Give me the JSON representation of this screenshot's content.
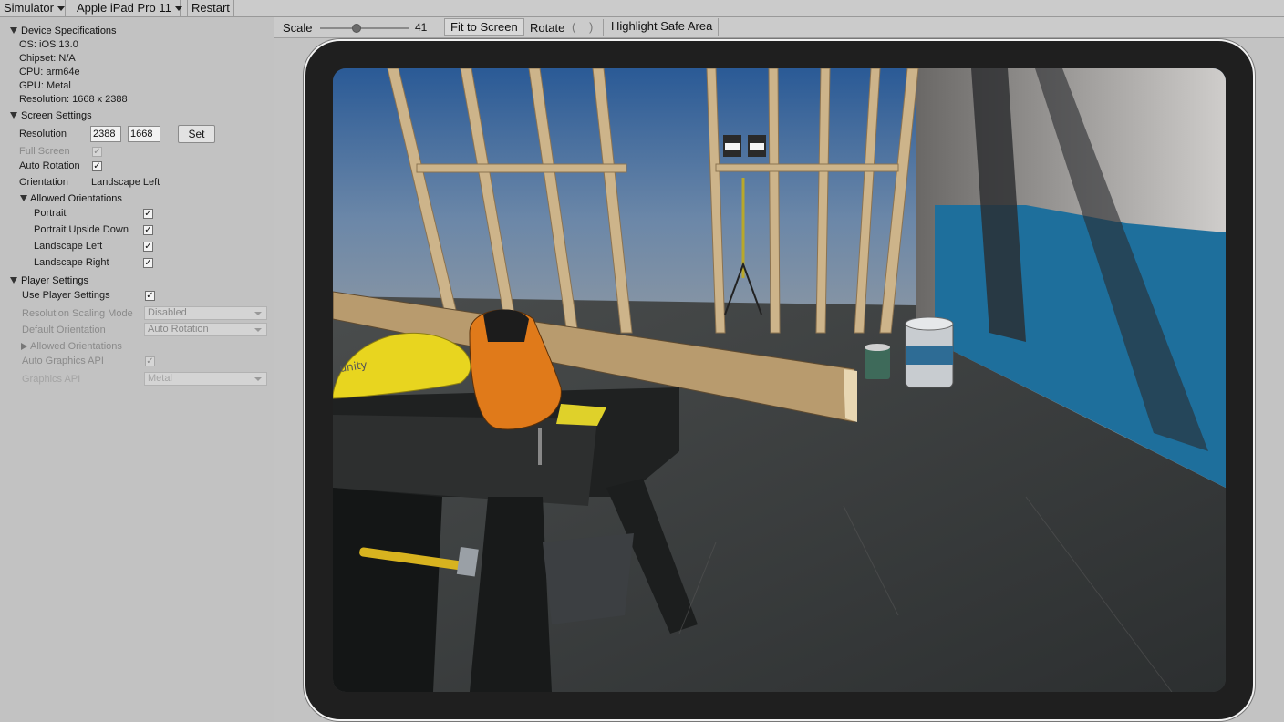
{
  "toolbar": {
    "simulator_label": "Simulator",
    "device_label": "Apple iPad Pro 11",
    "restart_label": "Restart"
  },
  "device_specs": {
    "title": "Device Specifications",
    "os": "OS: iOS 13.0",
    "chipset": "Chipset: N/A",
    "cpu": "CPU: arm64e",
    "gpu": "GPU: Metal",
    "resolution": "Resolution: 1668 x 2388"
  },
  "screen_settings": {
    "title": "Screen Settings",
    "resolution_label": "Resolution",
    "res_width": "2388",
    "res_height": "1668",
    "set_label": "Set",
    "full_screen_label": "Full Screen",
    "full_screen_checked": true,
    "auto_rotation_label": "Auto Rotation",
    "auto_rotation_checked": true,
    "orientation_label": "Orientation",
    "orientation_value": "Landscape Left",
    "allowed_orientations_title": "Allowed Orientations",
    "orientations": [
      {
        "label": "Portrait",
        "checked": true
      },
      {
        "label": "Portrait Upside Down",
        "checked": true
      },
      {
        "label": "Landscape Left",
        "checked": true
      },
      {
        "label": "Landscape Right",
        "checked": true
      }
    ]
  },
  "player_settings": {
    "title": "Player Settings",
    "use_player_settings_label": "Use Player Settings",
    "use_player_settings_checked": true,
    "resolution_scaling_label": "Resolution Scaling Mode",
    "resolution_scaling_value": "Disabled",
    "default_orientation_label": "Default Orientation",
    "default_orientation_value": "Auto Rotation",
    "allowed_orientations_label": "Allowed Orientations",
    "auto_graphics_label": "Auto Graphics API",
    "auto_graphics_checked": true,
    "graphics_api_label": "Graphics API",
    "graphics_api_value": "Metal"
  },
  "sim_toolbar": {
    "scale_label": "Scale",
    "scale_value": "41",
    "scale_fraction": 0.41,
    "fit_label": "Fit to Screen",
    "rotate_label": "Rotate",
    "highlight_label": "Highlight Safe Area"
  },
  "colors": {
    "panel": "#c2c2c2",
    "device_frame": "#1f1f1f",
    "device_bezel": "#f2f2f2",
    "paint_blue": "#1e6f9c",
    "hardhat_yellow": "#e8d51f",
    "saw_orange": "#e07a1a"
  }
}
